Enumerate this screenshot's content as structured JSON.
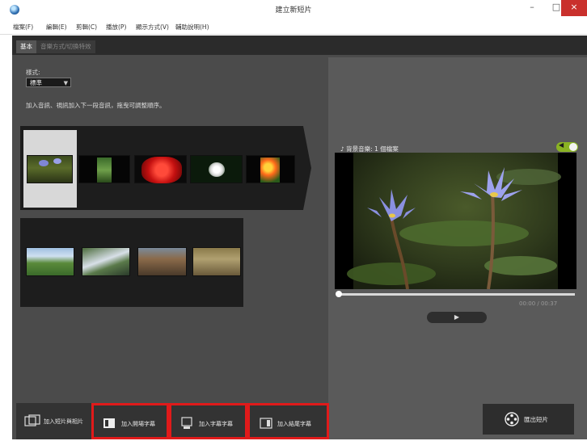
{
  "window": {
    "title": "建立新短片",
    "min_glyph": "–",
    "max_glyph": "□",
    "close_glyph": "×"
  },
  "menu": [
    "檔案(F)",
    "編輯(E)",
    "剪輯(C)",
    "播放(P)",
    "顯示方式(V)",
    "輔助說明(H)"
  ],
  "tabs": {
    "active": "基本",
    "inactive": "音樂方式/切換特效"
  },
  "style": {
    "label": "樣式:",
    "value": "標準"
  },
  "hint": "加入音訊、視訊加入下一段音訊，拖曳可調整順序。",
  "background_music": {
    "label": "♪ 背景音樂: 1 個檔案",
    "toggle_on": true
  },
  "player": {
    "timecode": "00:00 / 00:37",
    "play_glyph": "▶",
    "progress": 0
  },
  "bottom_buttons": [
    {
      "label": "加入短片與相片",
      "highlighted": false
    },
    {
      "label": "加入開場字幕",
      "highlighted": true
    },
    {
      "label": "加入字幕字幕",
      "highlighted": true
    },
    {
      "label": "加入結尾字幕",
      "highlighted": true
    }
  ],
  "export_button": {
    "label": "匯出短片"
  },
  "colors": {
    "panel": "#4b4b4b",
    "highlight": "#e01a1a",
    "toggle": "#8ab323"
  }
}
